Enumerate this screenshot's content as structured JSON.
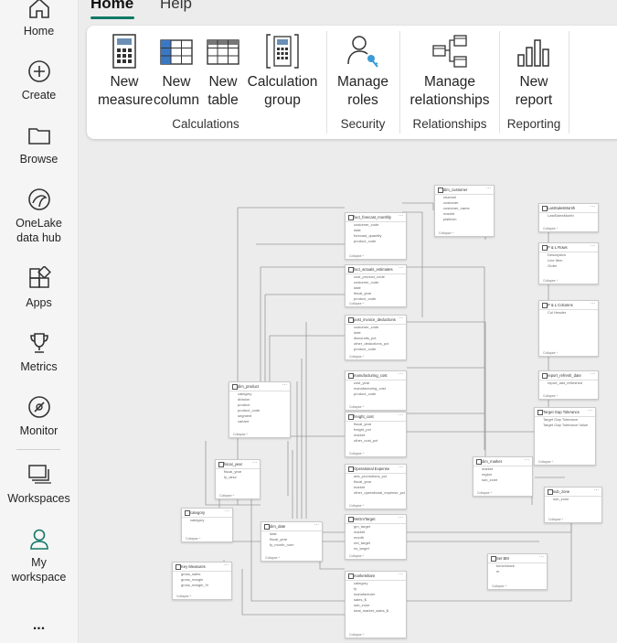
{
  "nav": {
    "items": [
      {
        "label": "Home",
        "icon": "home-icon"
      },
      {
        "label": "Create",
        "icon": "create-icon"
      },
      {
        "label": "Browse",
        "icon": "folder-icon"
      },
      {
        "label": "OneLake data hub",
        "icon": "onelake-icon"
      },
      {
        "label": "Apps",
        "icon": "apps-icon"
      },
      {
        "label": "Metrics",
        "icon": "trophy-icon"
      },
      {
        "label": "Monitor",
        "icon": "monitor-icon"
      },
      {
        "label": "Workspaces",
        "icon": "workspaces-icon"
      },
      {
        "label": "My workspace",
        "icon": "my-workspace-icon"
      }
    ],
    "more": "..."
  },
  "tabs": {
    "home": "Home",
    "help": "Help"
  },
  "ribbon": {
    "buttons": {
      "new_measure": "New measure",
      "new_column": "New column",
      "new_table": "New table",
      "calc_group": "Calculation group",
      "manage_roles": "Manage roles",
      "manage_relationships": "Manage relationships",
      "new_report": "New report"
    },
    "groups": {
      "calculations": "Calculations",
      "security": "Security",
      "relationships": "Relationships",
      "reporting": "Reporting"
    }
  },
  "colors": {
    "accent": "#117865",
    "ribbon_bg": "#ffffff",
    "canvas_bg": "#ececec"
  },
  "model": {
    "collapse_label": "Collapse",
    "tables": [
      {
        "name": "dim_customer",
        "fields": [
          "channel",
          "customer",
          "customer_name",
          "market",
          "platform"
        ]
      },
      {
        "name": "fact_forecast_monthly",
        "fields": [
          "customer_code",
          "date",
          "forecast_quantity",
          "product_code"
        ]
      },
      {
        "name": "fact_actuals_estimates",
        "fields": [
          "cust_product_code",
          "customer_code",
          "date",
          "fiscal_year",
          "product_code"
        ]
      },
      {
        "name": "post_invoice_deductions",
        "fields": [
          "customer_code",
          "date",
          "discounts_pct",
          "other_deductions_pct",
          "product_code"
        ]
      },
      {
        "name": "manufacturing_cost",
        "fields": [
          "cost_year",
          "manufacturing_cost",
          "product_code"
        ]
      },
      {
        "name": "freight_cost",
        "fields": [
          "fiscal_year",
          "freight_pct",
          "market",
          "other_cost_pct"
        ]
      },
      {
        "name": "Operational Expense",
        "fields": [
          "ads_promotions_pct",
          "fiscal_year",
          "market",
          "other_operational_expense_pct"
        ]
      },
      {
        "name": "NsGmTarget",
        "fields": [
          "gm_target",
          "market",
          "month",
          "net_target",
          "ns_target"
        ]
      },
      {
        "name": "marketshare",
        "fields": [
          "category",
          "fy",
          "manufacturer",
          "sales_$",
          "sub_zone",
          "total_market_sales_$"
        ]
      },
      {
        "name": "dim_product",
        "fields": [
          "category",
          "division",
          "product",
          "product_code",
          "segment",
          "variant"
        ]
      },
      {
        "name": "fiscal_year",
        "fields": [
          "fiscal_year",
          "fy_desc"
        ]
      },
      {
        "name": "category",
        "fields": [
          "category"
        ]
      },
      {
        "name": "dim_date",
        "fields": [
          "date",
          "fiscal_year",
          "fy_month_num"
        ]
      },
      {
        "name": "Key Measures",
        "fields": [
          "gross_sales",
          "gross_margin",
          "gross_margin_%"
        ]
      },
      {
        "name": "dim_market",
        "fields": [
          "market",
          "region",
          "sub_zone"
        ]
      },
      {
        "name": "sub_zone",
        "fields": [
          "sub_zone"
        ]
      },
      {
        "name": "Set BM",
        "fields": [
          "benchmark",
          "m"
        ]
      },
      {
        "name": "LastSalesMonth",
        "fields": [
          "LastSalesMonth"
        ]
      },
      {
        "name": "P & L Rows",
        "fields": [
          "Description",
          "Line Item",
          "Order"
        ]
      },
      {
        "name": "P & L Columns",
        "fields": [
          "Col Header"
        ]
      },
      {
        "name": "report_refresh_date",
        "fields": [
          "report_last_refreshed"
        ]
      },
      {
        "name": "Target Gap Tolerance",
        "fields": [
          "Target Gap Tolerance",
          "Target Gap Tolerance Value"
        ]
      }
    ]
  }
}
